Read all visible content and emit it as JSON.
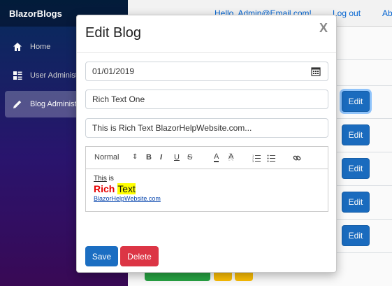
{
  "app": {
    "brand": "BlazorBlogs"
  },
  "sidebar": {
    "items": [
      {
        "label": "Home",
        "icon": "home-icon"
      },
      {
        "label": "User Administ",
        "icon": "list-icon"
      },
      {
        "label": "Blog Administ",
        "icon": "pencil-icon",
        "active": true
      }
    ]
  },
  "topbar": {
    "user": "Hello, Admin@Email.com!",
    "logout": "Log out",
    "about": "About"
  },
  "table": {
    "edit_labels": [
      "Edit",
      "Edit",
      "Edit",
      "Edit",
      "Edit"
    ]
  },
  "modal": {
    "title": "Edit Blog",
    "close": "X",
    "date_value": "01/01/2019",
    "title_value": "Rich Text One",
    "summary_value": "This is  Rich Text BlazorHelpWebsite.com...",
    "toolbar": {
      "format": "Normal",
      "format_arrow": "⇕",
      "bold": "B",
      "italic": "I",
      "underline": "U",
      "strike": "S",
      "color": "A",
      "background": "A"
    },
    "content": {
      "this": "This",
      "is": " is",
      "rich": "Rich",
      "text": "Text",
      "link": "BlazorHelpWebsite.com"
    },
    "save_label": "Save",
    "delete_label": "Delete"
  },
  "colors": {
    "primary": "#1b6ec2",
    "danger": "#dc3545",
    "success": "#28a745",
    "warning": "#ffc107",
    "rich_text_red": "#e60000",
    "highlight": "#ffff00"
  }
}
